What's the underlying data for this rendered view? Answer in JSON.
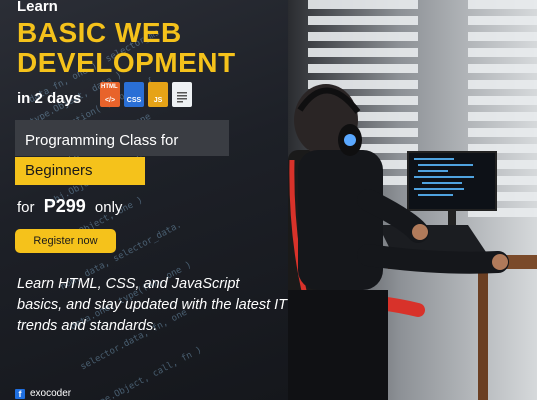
{
  "ad": {
    "learn": "Learn",
    "title_line1": "BASIC WEB",
    "title_line2": "DEVELOPMENT",
    "duration": "in 2 days",
    "file_icons": [
      {
        "label": "HTML",
        "icon": "html-file-icon",
        "color": "#e8632b"
      },
      {
        "label": "CSS",
        "icon": "css-file-icon",
        "color": "#2a6fd6"
      },
      {
        "label": "JS",
        "icon": "js-file-icon",
        "color": "#e6a317"
      },
      {
        "label": "",
        "icon": "document-file-icon",
        "color": "#eef1f4"
      }
    ],
    "class_label": "Programming Class for",
    "audience": "Beginners",
    "price_prefix": "for",
    "price": "P299",
    "price_suffix": "only",
    "cta_button": "Register now",
    "description": "Learn HTML, CSS, and JavaScript basics, and stay updated with the latest IT trends and standards.",
    "brand_name": "exocoder",
    "brand_icon": "facebook-icon"
  },
  "colors": {
    "accent": "#f5c21b",
    "panel_dark": "#1d2027",
    "box_gray": "#3a3d43"
  }
}
